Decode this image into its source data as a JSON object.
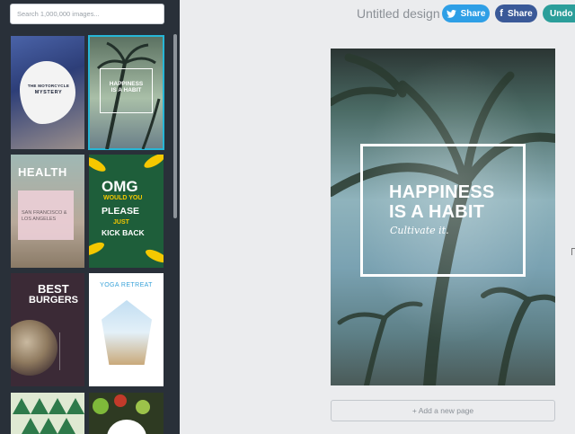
{
  "search": {
    "placeholder": "Search 1,000,000 images..."
  },
  "header": {
    "doc_title": "Untitled design",
    "twitter_share": "Share",
    "facebook_share": "Share",
    "undo": "Undo"
  },
  "templates": [
    {
      "line1": "THE MOTORCYCLE",
      "line2": "MYSTERY"
    },
    {
      "line1": "HAPPINESS",
      "line2": "IS A HABIT"
    },
    {
      "title": "HEALTH",
      "body": "SAN FRANCISCO & LOS ANGELES"
    },
    {
      "w1": "OMG",
      "w2": "WOULD YOU",
      "w3": "PLEASE",
      "w4": "JUST",
      "w5": "KICK BACK"
    },
    {
      "w1": "BEST",
      "w2": "BURGERS"
    },
    {
      "title": "YOGA RETREAT"
    }
  ],
  "canvas": {
    "headline_1": "HAPPINESS",
    "headline_2": "IS A HABIT",
    "subtitle": "Cultivate it."
  },
  "add_page": "+ Add a new page",
  "colors": {
    "sidebar": "#293039",
    "selected_outline": "#27b6d6",
    "twitter": "#2e9fe6",
    "facebook": "#3a5998",
    "undo": "#2b9e9a"
  }
}
